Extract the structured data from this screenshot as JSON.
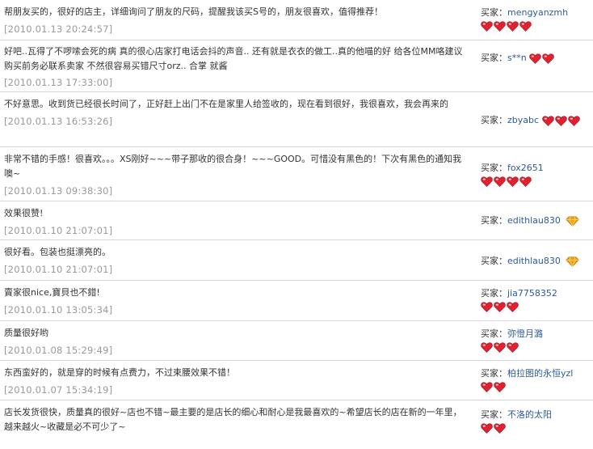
{
  "buyer_label": "买家：",
  "colors": {
    "heart": "#e02230",
    "diamond": "#f2a20c",
    "link": "#2d5a9a",
    "date": "#999999",
    "border": "#d8d8d8"
  },
  "reviews": [
    {
      "comment": "帮朋友买的，很好的店主，详细询问了朋友的尺码，提醒我该买S号的，朋友很喜欢，值得推荐！",
      "date": "[2010.01.13 20:24:57]",
      "buyer": "mengyanzmh",
      "badge": "heart",
      "badge_count": 4
    },
    {
      "comment": "好吧..瓦得了不啰嗦会死的病 真的很心店家打电话会抖的声音.. 还有就是衣衣的做工..真的他喵的好 给各位MM咯建议 购买前务必联系卖家 不然很容易买错尺寸orz.. 合掌 就酱",
      "date": "[2010.01.13 17:33:00]",
      "buyer": "s**n",
      "badge": "heart",
      "badge_count": 2
    },
    {
      "comment": "不好意思。收到货已经很长时间了，正好赶上出门不在是家里人给签收的，现在看到很好，我很喜欢，我会再来的",
      "date": "[2010.01.13 16:53:26]",
      "buyer": "zbyabc",
      "badge": "heart",
      "badge_count": 3
    },
    {
      "comment": "非常不错的手感！很喜欢。。。XS刚好~~~带子那收的很合身！~~~GOOD。可惜没有黑色的！下次有黑色的通知我噢~",
      "date": "[2010.01.13 09:38:30]",
      "buyer": "fox2651",
      "badge": "heart",
      "badge_count": 4
    },
    {
      "comment": "效果很赞!",
      "date": "[2010.01.10 21:07:01]",
      "buyer": "edithlau830",
      "badge": "diamond",
      "badge_count": 1
    },
    {
      "comment": "很好看。包装也挺漂亮的。",
      "date": "[2010.01.10 21:07:01]",
      "buyer": "edithlau830",
      "badge": "diamond",
      "badge_count": 1
    },
    {
      "comment": "賣家很nice,寶貝也不錯!",
      "date": "[2010.01.10 13:05:34]",
      "buyer": "jia7758352",
      "badge": "heart",
      "badge_count": 3
    },
    {
      "comment": "质量很好哟",
      "date": "[2010.01.08 15:29:49]",
      "buyer": "弥憕月潞",
      "badge": "heart",
      "badge_count": 3
    },
    {
      "comment": "东西蛮好的，就是穿的时候有点费力，不过束腰效果不错！",
      "date": "[2010.01.07 15:34:19]",
      "buyer": "柏拉图的永恒yzl",
      "badge": "heart",
      "badge_count": 2
    },
    {
      "comment": "店长发货很快，质量真的很好~店也不错~最主要的是店长的细心和耐心是我最喜欢的~希望店长的店在新的一年里，越来越火~收藏是必不可少了~",
      "date": "",
      "buyer": "不洛的太阳",
      "badge": "heart",
      "badge_count": 2
    }
  ]
}
